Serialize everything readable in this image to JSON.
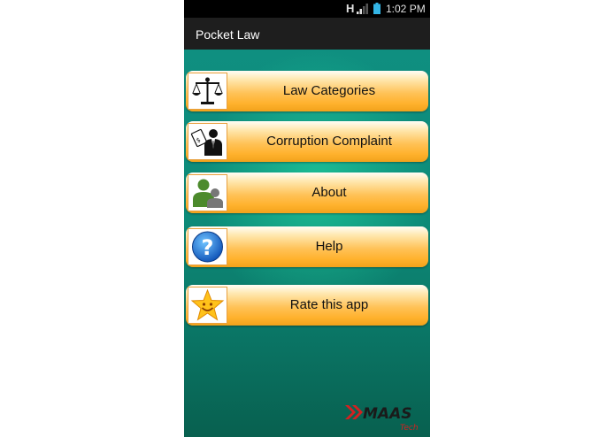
{
  "status_bar": {
    "network": "H",
    "time": "1:02 PM",
    "icons": [
      "signal-icon",
      "battery-icon"
    ]
  },
  "app": {
    "title": "Pocket Law"
  },
  "menu": [
    {
      "label": "Law Categories",
      "icon": "scales-icon"
    },
    {
      "label": "Corruption Complaint",
      "icon": "bribe-icon"
    },
    {
      "label": "About",
      "icon": "users-icon"
    },
    {
      "label": "Help",
      "icon": "question-icon"
    },
    {
      "label": "Rate this app",
      "icon": "star-smiley-icon"
    }
  ],
  "logo": {
    "brand": "MAAS",
    "sub": "Tech"
  },
  "colors": {
    "status_text": "#33b5e5",
    "action_bar": "#1e1e1e",
    "button_orange": "#ffb22e",
    "background_teal": "#0b7f6f",
    "logo_red": "#d42020"
  }
}
